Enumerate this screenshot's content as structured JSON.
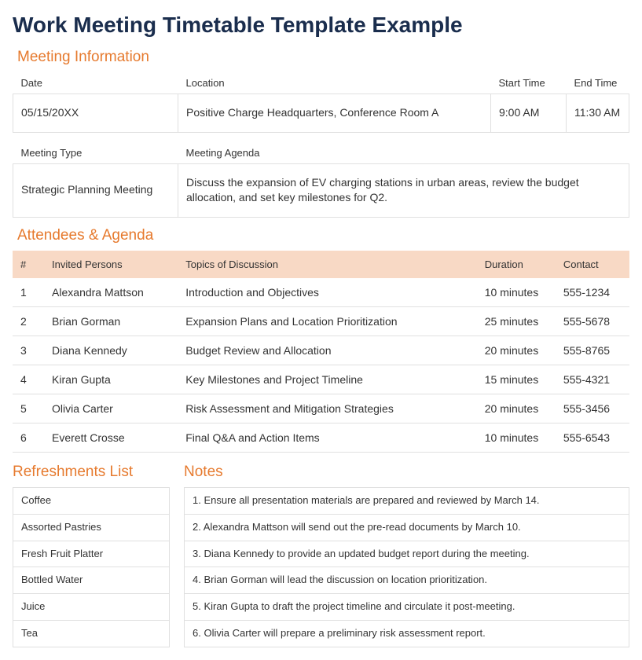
{
  "title": "Work Meeting Timetable Template Example",
  "sections": {
    "meeting_info": "Meeting Information",
    "attendees": "Attendees & Agenda",
    "refreshments": "Refreshments List",
    "notes": "Notes"
  },
  "meeting_info": {
    "headers": {
      "date": "Date",
      "location": "Location",
      "start_time": "Start Time",
      "end_time": "End Time",
      "meeting_type": "Meeting Type",
      "meeting_agenda": "Meeting Agenda"
    },
    "date": "05/15/20XX",
    "location": "Positive Charge Headquarters, Conference Room A",
    "start_time": "9:00 AM",
    "end_time": "11:30 AM",
    "meeting_type": "Strategic Planning Meeting",
    "meeting_agenda": "Discuss the expansion of EV charging stations in urban areas, review the budget allocation, and set key milestones for Q2."
  },
  "agenda": {
    "headers": {
      "num": "#",
      "invited": "Invited Persons",
      "topics": "Topics of Discussion",
      "duration": "Duration",
      "contact": "Contact"
    },
    "rows": [
      {
        "num": "1",
        "person": "Alexandra Mattson",
        "topic": "Introduction and Objectives",
        "duration": "10 minutes",
        "contact": "555-1234"
      },
      {
        "num": "2",
        "person": "Brian Gorman",
        "topic": "Expansion Plans and Location Prioritization",
        "duration": "25 minutes",
        "contact": "555-5678"
      },
      {
        "num": "3",
        "person": "Diana Kennedy",
        "topic": "Budget Review and Allocation",
        "duration": "20 minutes",
        "contact": "555-8765"
      },
      {
        "num": "4",
        "person": "Kiran Gupta",
        "topic": "Key Milestones and Project Timeline",
        "duration": "15 minutes",
        "contact": "555-4321"
      },
      {
        "num": "5",
        "person": "Olivia Carter",
        "topic": "Risk Assessment and Mitigation Strategies",
        "duration": "20 minutes",
        "contact": "555-3456"
      },
      {
        "num": "6",
        "person": "Everett Crosse",
        "topic": "Final Q&A and Action Items",
        "duration": "10 minutes",
        "contact": "555-6543"
      }
    ]
  },
  "refreshments": [
    "Coffee",
    "Assorted Pastries",
    "Fresh Fruit Platter",
    "Bottled Water",
    "Juice",
    "Tea"
  ],
  "notes": [
    "1. Ensure all presentation materials are prepared and reviewed by March 14.",
    "2. Alexandra Mattson will send out the pre-read documents by March 10.",
    "3. Diana Kennedy to provide an updated budget report during the meeting.",
    "4. Brian Gorman will lead the discussion on location prioritization.",
    "5. Kiran Gupta to draft the project timeline and circulate it post-meeting.",
    "6. Olivia Carter will prepare a preliminary risk assessment report."
  ]
}
